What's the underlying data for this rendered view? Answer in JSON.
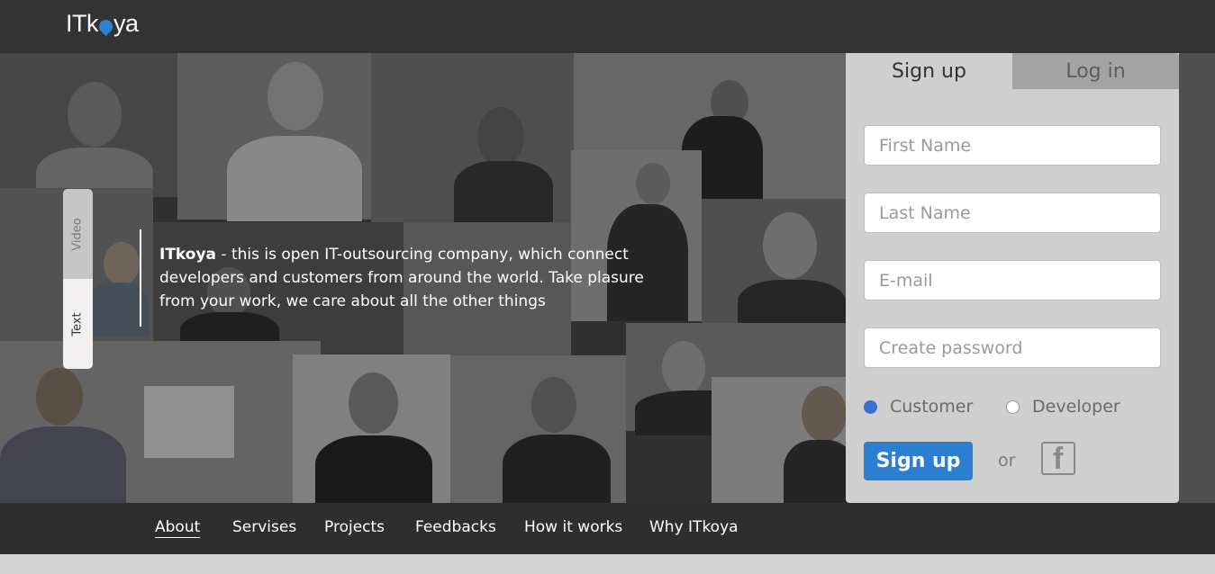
{
  "header": {
    "logo_text_start": "ITk",
    "logo_text_end": "ya"
  },
  "hero": {
    "side_tabs": [
      "Video",
      "Text"
    ],
    "intro_brand": "ITkoya",
    "intro_text": " - this is open IT-outsourcing company, which connect developers and customers from around the world. Take plasure from your work, we care about all the other things"
  },
  "signup": {
    "tabs": [
      "Sign up",
      "Log in"
    ],
    "first_name_placeholder": "First Name",
    "last_name_placeholder": "Last Name",
    "email_placeholder": "E-mail",
    "password_placeholder": "Create password",
    "role_options": [
      "Customer",
      "Developer"
    ],
    "selected_role": "Customer",
    "submit_label": "Sign up",
    "or_text": "or",
    "facebook_icon_glyph": "f"
  },
  "nav": {
    "items": [
      "About",
      "Servises",
      "Projects",
      "Feedbacks",
      "How it works",
      "Why ITkoya"
    ],
    "active": "About"
  },
  "colors": {
    "topbar": "#333333",
    "accent": "#2b7fd2",
    "panel": "#cfcfcf"
  }
}
